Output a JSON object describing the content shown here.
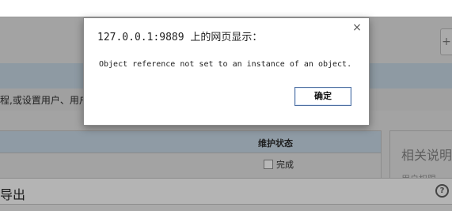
{
  "background_page": {
    "top_right_button_label": "+",
    "description_text": "程,或设置用户、用户",
    "table": {
      "column_header": "维护状态",
      "row_label": "完成"
    },
    "side_panel": {
      "title": "相关说明",
      "subtitle": "用户权限"
    },
    "footer": {
      "title": "导出",
      "help_label": "?"
    }
  },
  "dialog": {
    "title": "127.0.0.1:9889 上的网页显示：",
    "message": "Object reference not set to an instance of an object.",
    "close_label": "×",
    "ok_label": "确定"
  },
  "colors": {
    "overlay_gray": "#a2a2a2",
    "header_band": "#8e9aa3",
    "ok_border": "#4f70a2"
  }
}
